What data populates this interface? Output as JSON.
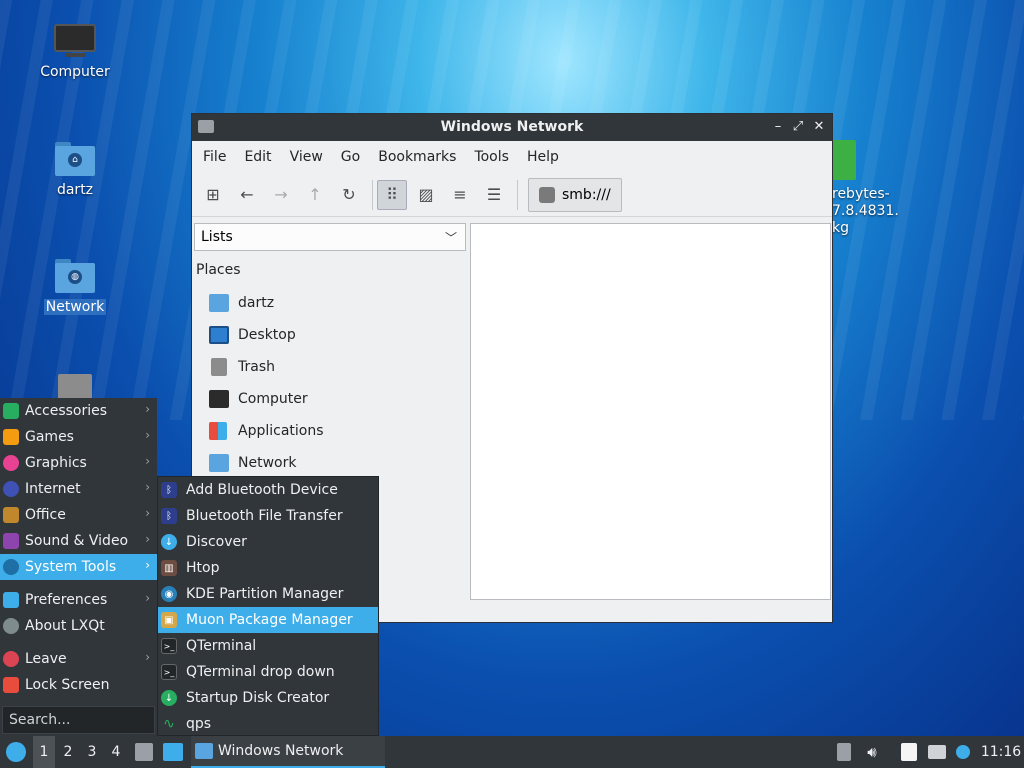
{
  "desktop": {
    "icons": [
      {
        "label": "Computer"
      },
      {
        "label": "dartz"
      },
      {
        "label": "Network"
      }
    ],
    "partial_label_lines": [
      "rebytes-",
      "7.8.4831.",
      "kg"
    ]
  },
  "window": {
    "title": "Windows Network",
    "menu": [
      "File",
      "Edit",
      "View",
      "Go",
      "Bookmarks",
      "Tools",
      "Help"
    ],
    "path": "smb:///",
    "side_combo": "Lists",
    "places_header": "Places",
    "places": [
      {
        "label": "dartz",
        "icon": "home-folder-icon",
        "color": "#5aa4e0"
      },
      {
        "label": "Desktop",
        "icon": "desktop-icon",
        "color": "#2f7fd1"
      },
      {
        "label": "Trash",
        "icon": "trash-icon",
        "color": "#8c8c8c"
      },
      {
        "label": "Computer",
        "icon": "computer-icon",
        "color": "#2b2b2b"
      },
      {
        "label": "Applications",
        "icon": "applications-icon",
        "color": "#e74c3c"
      },
      {
        "label": "Network",
        "icon": "network-folder-icon",
        "color": "#5aa4e0"
      }
    ]
  },
  "start_menu": {
    "items": [
      {
        "label": "Accessories",
        "icon": "accessories-icon",
        "color": "#27ae60",
        "arrow": true
      },
      {
        "label": "Games",
        "icon": "games-icon",
        "color": "#f39c12",
        "arrow": true
      },
      {
        "label": "Graphics",
        "icon": "graphics-icon",
        "color": "#e84393",
        "arrow": true
      },
      {
        "label": "Internet",
        "icon": "internet-icon",
        "color": "#3f51b5",
        "arrow": true
      },
      {
        "label": "Office",
        "icon": "office-icon",
        "color": "#c0872c",
        "arrow": true
      },
      {
        "label": "Sound & Video",
        "icon": "sound-video-icon",
        "color": "#8e44ad",
        "arrow": true
      },
      {
        "label": "System Tools",
        "icon": "system-tools-icon",
        "color": "#3daee9",
        "arrow": true,
        "highlight": true
      }
    ],
    "items2": [
      {
        "label": "Preferences",
        "icon": "preferences-icon",
        "color": "#3daee9",
        "arrow": true
      },
      {
        "label": "About LXQt",
        "icon": "info-icon",
        "color": "#7f8c8d",
        "arrow": false
      }
    ],
    "items3": [
      {
        "label": "Leave",
        "icon": "power-icon",
        "color": "#da4453",
        "arrow": true
      },
      {
        "label": "Lock Screen",
        "icon": "lock-icon",
        "color": "#e74c3c",
        "arrow": false
      }
    ],
    "search_placeholder": "Search..."
  },
  "submenu": {
    "items": [
      {
        "label": "Add Bluetooth Device",
        "icon": "bluetooth-icon",
        "color": "#2c3e8c",
        "glyph": "ᛒ"
      },
      {
        "label": "Bluetooth File Transfer",
        "icon": "bluetooth-icon",
        "color": "#2c3e8c",
        "glyph": "ᛒ"
      },
      {
        "label": "Discover",
        "icon": "discover-icon",
        "color": "#3daee9",
        "glyph": "↓"
      },
      {
        "label": "Htop",
        "icon": "htop-icon",
        "color": "#6d4c41",
        "glyph": "▥"
      },
      {
        "label": "KDE Partition Manager",
        "icon": "partition-manager-icon",
        "color": "#2980b9",
        "glyph": "◉"
      },
      {
        "label": "Muon Package Manager",
        "icon": "package-manager-icon",
        "color": "#d4a84a",
        "glyph": "▣",
        "highlight": true
      },
      {
        "label": "QTerminal",
        "icon": "terminal-icon",
        "color": "#232629",
        "glyph": ">_"
      },
      {
        "label": "QTerminal drop down",
        "icon": "terminal-icon",
        "color": "#232629",
        "glyph": ">_"
      },
      {
        "label": "Startup Disk Creator",
        "icon": "startup-disk-icon",
        "color": "#27ae60",
        "glyph": "↓"
      },
      {
        "label": "qps",
        "icon": "qps-icon",
        "color": "#27ae60",
        "glyph": "∿"
      }
    ]
  },
  "taskbar": {
    "workspaces": [
      "1",
      "2",
      "3",
      "4"
    ],
    "task_label": "Windows Network",
    "clock": "11:16"
  }
}
